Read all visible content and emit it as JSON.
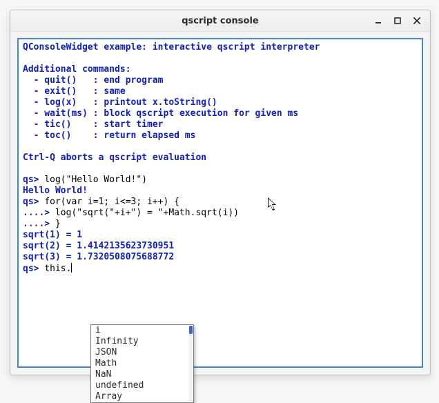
{
  "titlebar": {
    "title": "qscript console"
  },
  "help_text": "QConsoleWidget example: interactive qscript interpreter\n\nAdditional commands:\n  - quit()   : end program\n  - exit()   : same\n  - log(x)   : printout x.toString()\n  - wait(ms) : block qscript execution for given ms\n  - tic()    : start timer\n  - toc()    : return elapsed ms\n\nCtrl-Q aborts a qscript evaluation\n",
  "prompt": "qs> ",
  "cont_prompt": "....> ",
  "lines": {
    "cmd1": "log(\"Hello World!\")",
    "out1": "Hello World!",
    "cmd2": "for(var i=1; i<=3; i++) {",
    "cont1": "log(\"sqrt(\"+i+\") = \"+Math.sqrt(i))",
    "cont2": "}",
    "r1": "sqrt(1) = 1",
    "r2": "sqrt(2) = 1.4142135623730951",
    "r3": "sqrt(3) = 1.7320508075688772",
    "current": "this."
  },
  "completion": {
    "items": [
      "i",
      "Infinity",
      "JSON",
      "Math",
      "NaN",
      "undefined",
      "Array"
    ]
  }
}
